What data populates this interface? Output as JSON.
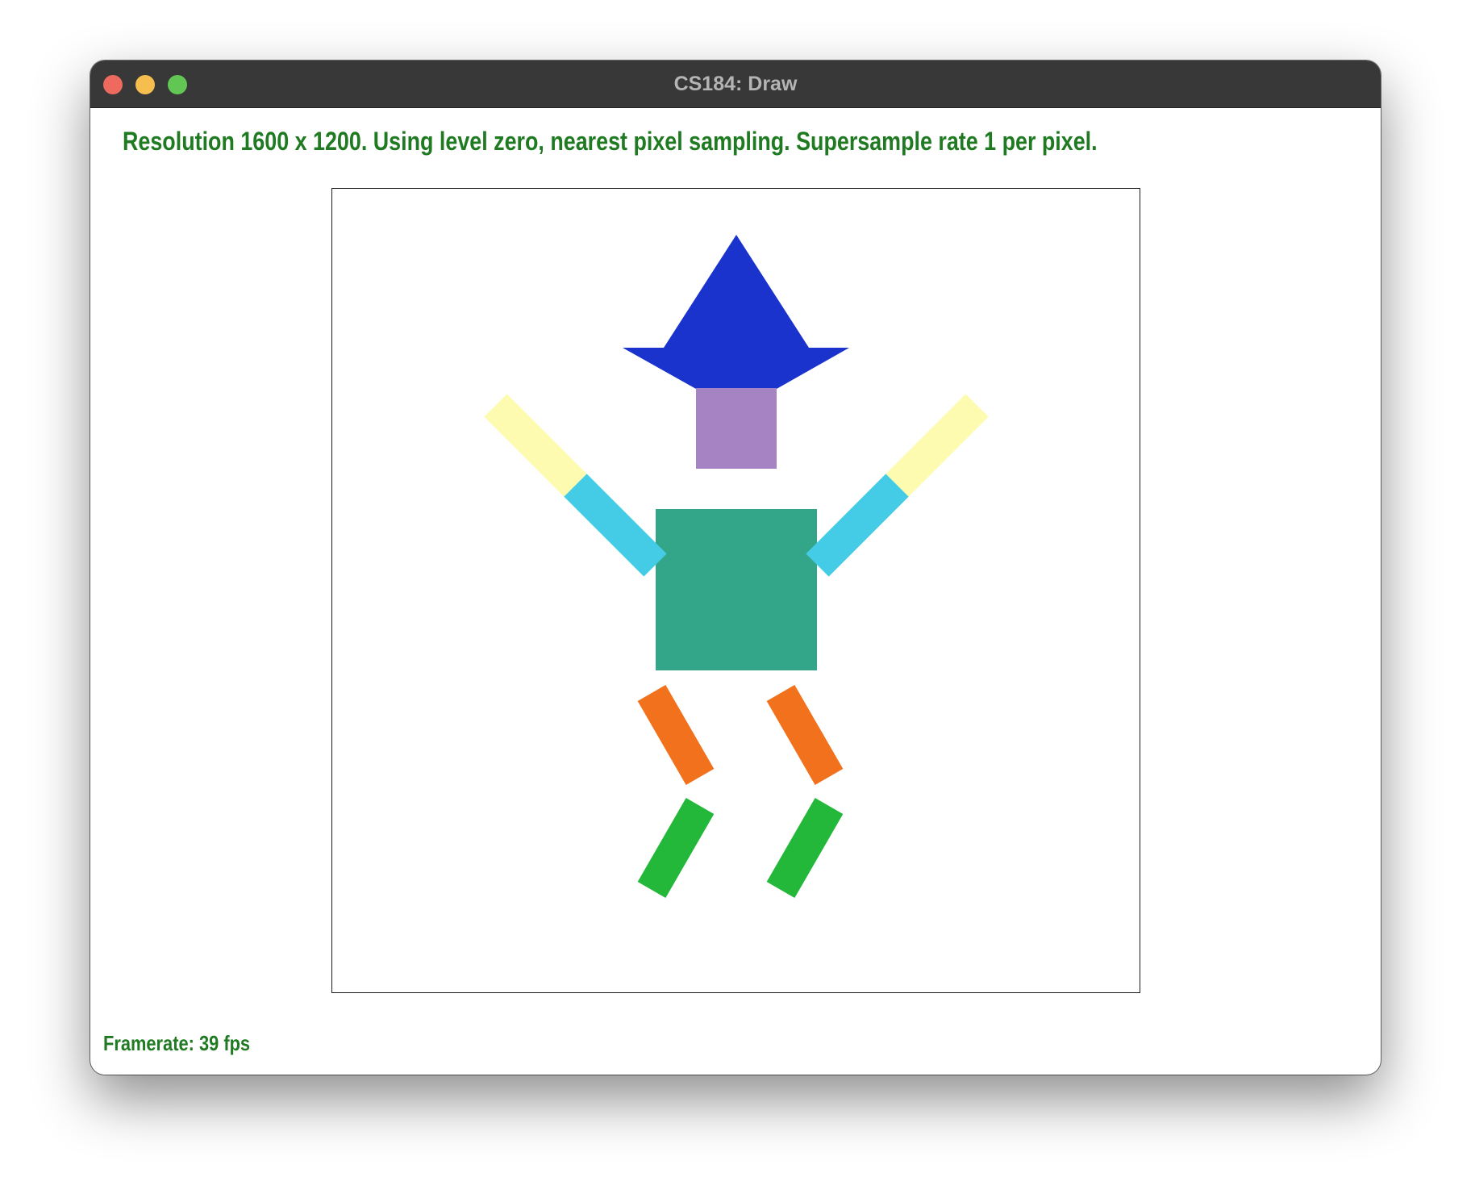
{
  "window": {
    "title": "CS184: Draw",
    "buttons": {
      "close_color": "#ee6a5f",
      "minimize_color": "#f5be4f",
      "maximize_color": "#62c655"
    }
  },
  "status": {
    "text": "Resolution 1600 x 1200. Using level zero, nearest pixel sampling. Supersample rate 1 per pixel.",
    "color": "#1f7a22"
  },
  "framerate": {
    "text": "Framerate: 39 fps"
  },
  "figure": {
    "hat_color": "#1a33cc",
    "head_color": "#a683c3",
    "body_color": "#33a68a",
    "upper_arm_color": "#fcfbb0",
    "forearm_color": "#44cce6",
    "thigh_color": "#f2711c",
    "shin_color": "#24b83a"
  }
}
